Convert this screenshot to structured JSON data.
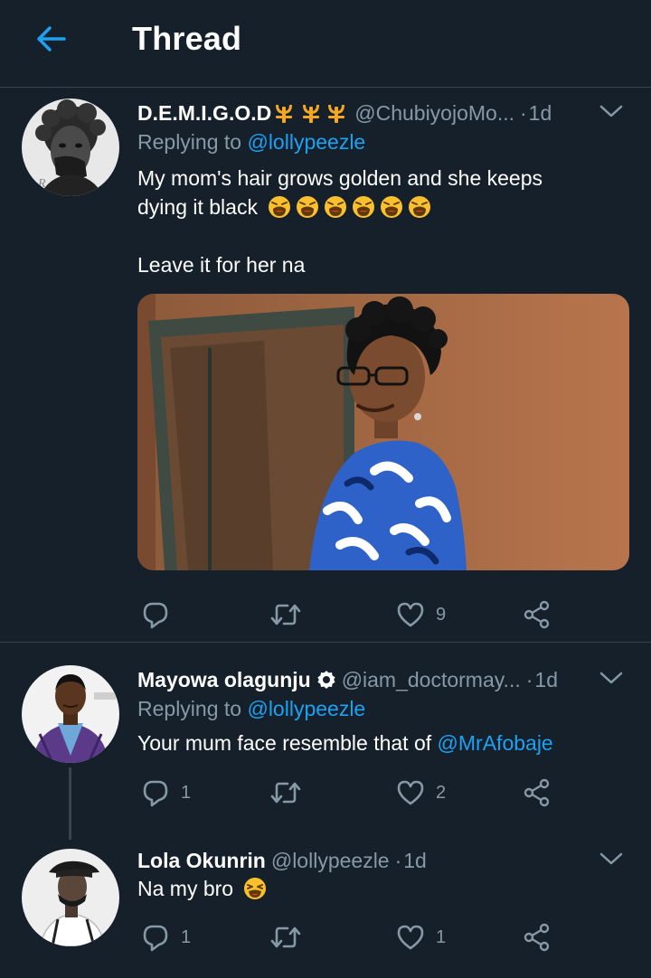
{
  "header": {
    "title": "Thread"
  },
  "tweets": [
    {
      "name": "D.E.M.I.G.O.D",
      "handle": "@ChubiyojoMo...",
      "dot": "·",
      "time": "1d",
      "replying_prefix": "Replying to",
      "replying_to": "@lollypeezle",
      "text_line1": "My mom's hair grows golden and she keeps",
      "text_line2": "dying it black",
      "text_line3": "Leave it for her na",
      "emoji": "tired-face-emoji",
      "emoji_count": 6,
      "replies": "",
      "retweets": "",
      "likes": "9"
    },
    {
      "name": "Mayowa olagunju",
      "handle": "@iam_doctormay...",
      "dot": "·",
      "time": "1d",
      "replying_prefix": "Replying to",
      "replying_to": "@lollypeezle",
      "text": "Your mum face resemble that of",
      "text_mention": "@MrAfobaje",
      "replies": "1",
      "retweets": "",
      "likes": "2"
    },
    {
      "name": "Lola Okunrin",
      "handle": "@lollypeezle",
      "dot": "·",
      "time": "1d",
      "text": "Na my bro",
      "emoji": "laughing-face-emoji",
      "replies": "1",
      "retweets": "",
      "likes": "1"
    }
  ],
  "colors": {
    "background": "#15202b",
    "accent": "#1da1f2",
    "secondary_text": "#8899a6",
    "divider": "#38444d"
  }
}
